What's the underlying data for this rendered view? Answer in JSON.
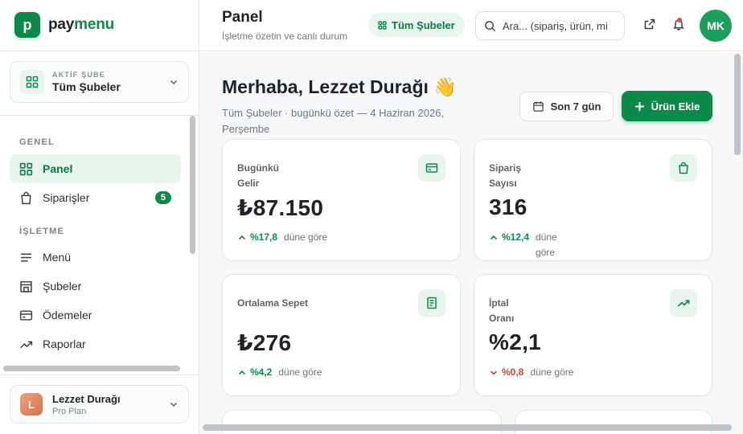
{
  "brand": {
    "prefix": "pay",
    "suffix": "menu",
    "mark": "p"
  },
  "branch": {
    "small_label": "AKTİF ŞUBE",
    "name": "Tüm Şubeler"
  },
  "nav": {
    "section_general": "GENEL",
    "section_business": "İŞLETME",
    "items": [
      {
        "label": "Panel",
        "icon": "grid-icon"
      },
      {
        "label": "Siparişler",
        "icon": "bag-icon",
        "badge": "5"
      },
      {
        "label": "Menü",
        "icon": "menu-lines-icon"
      },
      {
        "label": "Şubeler",
        "icon": "store-icon"
      },
      {
        "label": "Ödemeler",
        "icon": "card-icon"
      },
      {
        "label": "Raporlar",
        "icon": "trend-icon"
      }
    ]
  },
  "user": {
    "initial": "L",
    "name": "Lezzet Durağı",
    "plan": "Pro Plan"
  },
  "header": {
    "title": "Panel",
    "subtitle": "İşletme özetin ve canlı durum",
    "branch_pill": "Tüm Şubeler",
    "search_placeholder": "Ara... (sipariş, ürün, mi",
    "avatar": "MK"
  },
  "greeting": {
    "title": "Merhaba, Lezzet Durağı 👋",
    "subtitle": "Tüm Şubeler · bugünkü özet — 4 Haziran 2026, Perşembe"
  },
  "actions": {
    "range_label": "Son 7 gün",
    "add_label": "Ürün Ekle"
  },
  "colors": {
    "accent": "#0b8a4a",
    "accent_soft": "#e7f5ec",
    "negative": "#d13f34"
  },
  "stats": [
    {
      "label": "Bugünkü Gelir",
      "value": "₺87.150",
      "delta": "%17,8",
      "compare": "düne göre",
      "direction": "up",
      "icon": "card-icon"
    },
    {
      "label": "Sipariş Sayısı",
      "value": "316",
      "delta": "%12,4",
      "compare": "düne göre",
      "direction": "up",
      "icon": "bag-icon"
    },
    {
      "label": "Ortalama Sepet",
      "value": "₺276",
      "delta": "%4,2",
      "compare": "düne göre",
      "direction": "up",
      "icon": "receipt-icon"
    },
    {
      "label": "İptal Oranı",
      "value": "%2,1",
      "delta": "%0,8",
      "compare": "düne göre",
      "direction": "down",
      "icon": "trend-icon"
    }
  ]
}
